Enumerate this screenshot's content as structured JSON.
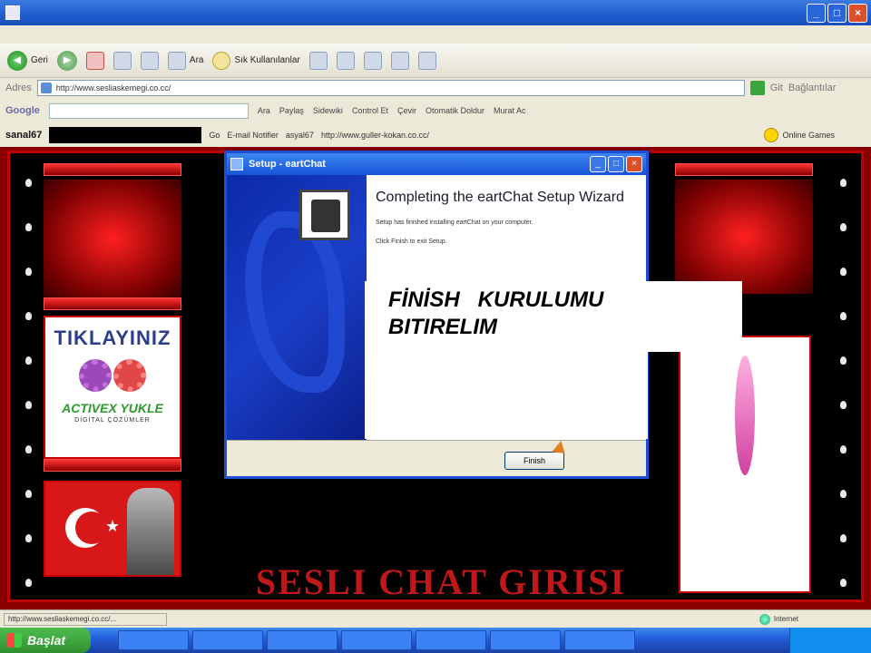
{
  "browser": {
    "title": "",
    "nav": {
      "back_label": "Geri",
      "search_label": "Ara",
      "favorites_label": "Sık Kullanılanlar"
    },
    "address": "http://www.sesliaskemegi.co.cc/",
    "go_label": "Git",
    "links_label": "Bağlantılar"
  },
  "google_bar": {
    "logo": "Google",
    "search_label": "Ara",
    "share_label": "Paylaş",
    "sidewiki_label": "Sidewiki",
    "controls": "Control Et",
    "translate_label": "Çevir",
    "autofill_label": "Otomatik Doldur",
    "user": "Murat Ac"
  },
  "user_bar": {
    "username": "sanal67",
    "go_label": "Go",
    "email_label": "E-mail Notifier",
    "user_label": "asyal67",
    "url_label": "http://www.guller-kokan.co.cc/",
    "games_label": "Online Games"
  },
  "site": {
    "title": "SESLI CHAT GIRISI",
    "banner_top": "TIKLAYINIZ",
    "banner_bottom": "ACTIVEX YUKLE",
    "banner_sub": "DİGİTAL ÇÖZÜMLER"
  },
  "dialog": {
    "title": "Setup - eartChat",
    "heading": "Completing the eartChat Setup Wizard",
    "p1": "Setup has finished installing eartChat on your computer.",
    "p2": "Click Finish to exit Setup.",
    "finish_label": "Finish"
  },
  "overlay": {
    "text": "FİNİSH   KURULUMU\nBITIRELIM"
  },
  "status": {
    "url": "http://www.sesliaskemegi.co.cc/...",
    "zone": "Internet"
  },
  "taskbar": {
    "start_label": "Başlat"
  }
}
